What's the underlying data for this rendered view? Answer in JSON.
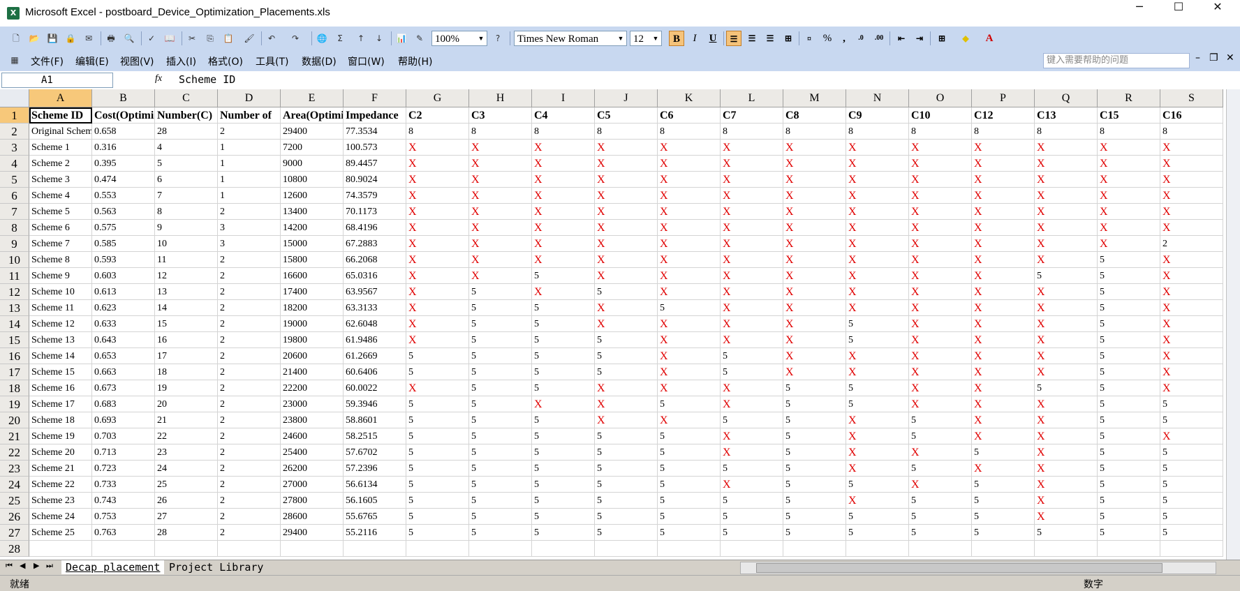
{
  "window": {
    "title": "Microsoft Excel - postboard_Device_Optimization_Placements.xls",
    "minimize": "─",
    "maximize": "☐",
    "close": "✕"
  },
  "toolbar": {
    "zoom": "100%",
    "font": "Times New Roman",
    "font_size": "12",
    "bold": "B",
    "italic": "I",
    "underline": "U",
    "percent": "%",
    "comma": ","
  },
  "menu": {
    "items": [
      "文件(F)",
      "编辑(E)",
      "视图(V)",
      "插入(I)",
      "格式(O)",
      "工具(T)",
      "数据(D)",
      "窗口(W)",
      "帮助(H)"
    ],
    "help_placeholder": "键入需要帮助的问题"
  },
  "formula_bar": {
    "name_box": "A1",
    "fx": "fx",
    "formula": "Scheme ID"
  },
  "sheet": {
    "columns": [
      "A",
      "B",
      "C",
      "D",
      "E",
      "F",
      "G",
      "H",
      "I",
      "J",
      "K",
      "L",
      "M",
      "N",
      "O",
      "P",
      "Q",
      "R",
      "S"
    ],
    "row_numbers": [
      "1",
      "2",
      "3",
      "4",
      "5",
      "6",
      "7",
      "8",
      "9",
      "10",
      "11",
      "12",
      "13",
      "14",
      "15",
      "16",
      "17",
      "18",
      "19",
      "20",
      "21",
      "22",
      "23",
      "24",
      "25",
      "26",
      "27",
      "28"
    ],
    "rows": [
      [
        "Scheme ID",
        "Cost(Optimized)",
        "Number(C)",
        "Number of",
        "Area(Optimized)",
        "Impedance",
        "C2",
        "C3",
        "C4",
        "C5",
        "C6",
        "C7",
        "C8",
        "C9",
        "C10",
        "C12",
        "C13",
        "C15",
        "C16"
      ],
      [
        "Original Scheme",
        "0.658",
        "28",
        "2",
        "29400",
        "77.3534",
        "8",
        "8",
        "8",
        "8",
        "8",
        "8",
        "8",
        "8",
        "8",
        "8",
        "8",
        "8",
        "8"
      ],
      [
        "Scheme 1",
        "0.316",
        "4",
        "1",
        "7200",
        "100.573",
        "X",
        "X",
        "X",
        "X",
        "X",
        "X",
        "X",
        "X",
        "X",
        "X",
        "X",
        "X",
        "X"
      ],
      [
        "Scheme 2",
        "0.395",
        "5",
        "1",
        "9000",
        "89.4457",
        "X",
        "X",
        "X",
        "X",
        "X",
        "X",
        "X",
        "X",
        "X",
        "X",
        "X",
        "X",
        "X"
      ],
      [
        "Scheme 3",
        "0.474",
        "6",
        "1",
        "10800",
        "80.9024",
        "X",
        "X",
        "X",
        "X",
        "X",
        "X",
        "X",
        "X",
        "X",
        "X",
        "X",
        "X",
        "X"
      ],
      [
        "Scheme 4",
        "0.553",
        "7",
        "1",
        "12600",
        "74.3579",
        "X",
        "X",
        "X",
        "X",
        "X",
        "X",
        "X",
        "X",
        "X",
        "X",
        "X",
        "X",
        "X"
      ],
      [
        "Scheme 5",
        "0.563",
        "8",
        "2",
        "13400",
        "70.1173",
        "X",
        "X",
        "X",
        "X",
        "X",
        "X",
        "X",
        "X",
        "X",
        "X",
        "X",
        "X",
        "X"
      ],
      [
        "Scheme 6",
        "0.575",
        "9",
        "3",
        "14200",
        "68.4196",
        "X",
        "X",
        "X",
        "X",
        "X",
        "X",
        "X",
        "X",
        "X",
        "X",
        "X",
        "X",
        "X"
      ],
      [
        "Scheme 7",
        "0.585",
        "10",
        "3",
        "15000",
        "67.2883",
        "X",
        "X",
        "X",
        "X",
        "X",
        "X",
        "X",
        "X",
        "X",
        "X",
        "X",
        "X",
        "2"
      ],
      [
        "Scheme 8",
        "0.593",
        "11",
        "2",
        "15800",
        "66.2068",
        "X",
        "X",
        "X",
        "X",
        "X",
        "X",
        "X",
        "X",
        "X",
        "X",
        "X",
        "5",
        "X"
      ],
      [
        "Scheme 9",
        "0.603",
        "12",
        "2",
        "16600",
        "65.0316",
        "X",
        "X",
        "5",
        "X",
        "X",
        "X",
        "X",
        "X",
        "X",
        "X",
        "5",
        "5",
        "X"
      ],
      [
        "Scheme 10",
        "0.613",
        "13",
        "2",
        "17400",
        "63.9567",
        "X",
        "5",
        "X",
        "5",
        "X",
        "X",
        "X",
        "X",
        "X",
        "X",
        "X",
        "5",
        "X"
      ],
      [
        "Scheme 11",
        "0.623",
        "14",
        "2",
        "18200",
        "63.3133",
        "X",
        "5",
        "5",
        "X",
        "5",
        "X",
        "X",
        "X",
        "X",
        "X",
        "X",
        "5",
        "X"
      ],
      [
        "Scheme 12",
        "0.633",
        "15",
        "2",
        "19000",
        "62.6048",
        "X",
        "5",
        "5",
        "X",
        "X",
        "X",
        "X",
        "5",
        "X",
        "X",
        "X",
        "5",
        "X"
      ],
      [
        "Scheme 13",
        "0.643",
        "16",
        "2",
        "19800",
        "61.9486",
        "X",
        "5",
        "5",
        "5",
        "X",
        "X",
        "X",
        "5",
        "X",
        "X",
        "X",
        "5",
        "X"
      ],
      [
        "Scheme 14",
        "0.653",
        "17",
        "2",
        "20600",
        "61.2669",
        "5",
        "5",
        "5",
        "5",
        "X",
        "5",
        "X",
        "X",
        "X",
        "X",
        "X",
        "5",
        "X"
      ],
      [
        "Scheme 15",
        "0.663",
        "18",
        "2",
        "21400",
        "60.6406",
        "5",
        "5",
        "5",
        "5",
        "X",
        "5",
        "X",
        "X",
        "X",
        "X",
        "X",
        "5",
        "X"
      ],
      [
        "Scheme 16",
        "0.673",
        "19",
        "2",
        "22200",
        "60.0022",
        "X",
        "5",
        "5",
        "X",
        "X",
        "X",
        "5",
        "5",
        "X",
        "X",
        "5",
        "5",
        "X"
      ],
      [
        "Scheme 17",
        "0.683",
        "20",
        "2",
        "23000",
        "59.3946",
        "5",
        "5",
        "X",
        "X",
        "5",
        "X",
        "5",
        "5",
        "X",
        "X",
        "X",
        "5",
        "5"
      ],
      [
        "Scheme 18",
        "0.693",
        "21",
        "2",
        "23800",
        "58.8601",
        "5",
        "5",
        "5",
        "X",
        "X",
        "5",
        "5",
        "X",
        "5",
        "X",
        "X",
        "5",
        "5"
      ],
      [
        "Scheme 19",
        "0.703",
        "22",
        "2",
        "24600",
        "58.2515",
        "5",
        "5",
        "5",
        "5",
        "5",
        "X",
        "5",
        "X",
        "5",
        "X",
        "X",
        "5",
        "X"
      ],
      [
        "Scheme 20",
        "0.713",
        "23",
        "2",
        "25400",
        "57.6702",
        "5",
        "5",
        "5",
        "5",
        "5",
        "X",
        "5",
        "X",
        "X",
        "5",
        "X",
        "5",
        "5"
      ],
      [
        "Scheme 21",
        "0.723",
        "24",
        "2",
        "26200",
        "57.2396",
        "5",
        "5",
        "5",
        "5",
        "5",
        "5",
        "5",
        "X",
        "5",
        "X",
        "X",
        "5",
        "5"
      ],
      [
        "Scheme 22",
        "0.733",
        "25",
        "2",
        "27000",
        "56.6134",
        "5",
        "5",
        "5",
        "5",
        "5",
        "X",
        "5",
        "5",
        "X",
        "5",
        "X",
        "5",
        "5"
      ],
      [
        "Scheme 23",
        "0.743",
        "26",
        "2",
        "27800",
        "56.1605",
        "5",
        "5",
        "5",
        "5",
        "5",
        "5",
        "5",
        "X",
        "5",
        "5",
        "X",
        "5",
        "5"
      ],
      [
        "Scheme 24",
        "0.753",
        "27",
        "2",
        "28600",
        "55.6765",
        "5",
        "5",
        "5",
        "5",
        "5",
        "5",
        "5",
        "5",
        "5",
        "5",
        "X",
        "5",
        "5"
      ],
      [
        "Scheme 25",
        "0.763",
        "28",
        "2",
        "29400",
        "55.2116",
        "5",
        "5",
        "5",
        "5",
        "5",
        "5",
        "5",
        "5",
        "5",
        "5",
        "5",
        "5",
        "5"
      ],
      [
        "",
        "",
        "",
        "",
        "",
        "",
        "",
        "",
        "",
        "",
        "",
        "",
        "",
        "",
        "",
        "",
        "",
        "",
        ""
      ]
    ]
  },
  "tabs": [
    "Decap placement",
    "Project Library"
  ],
  "status": {
    "left": "就绪",
    "right": "数字"
  }
}
